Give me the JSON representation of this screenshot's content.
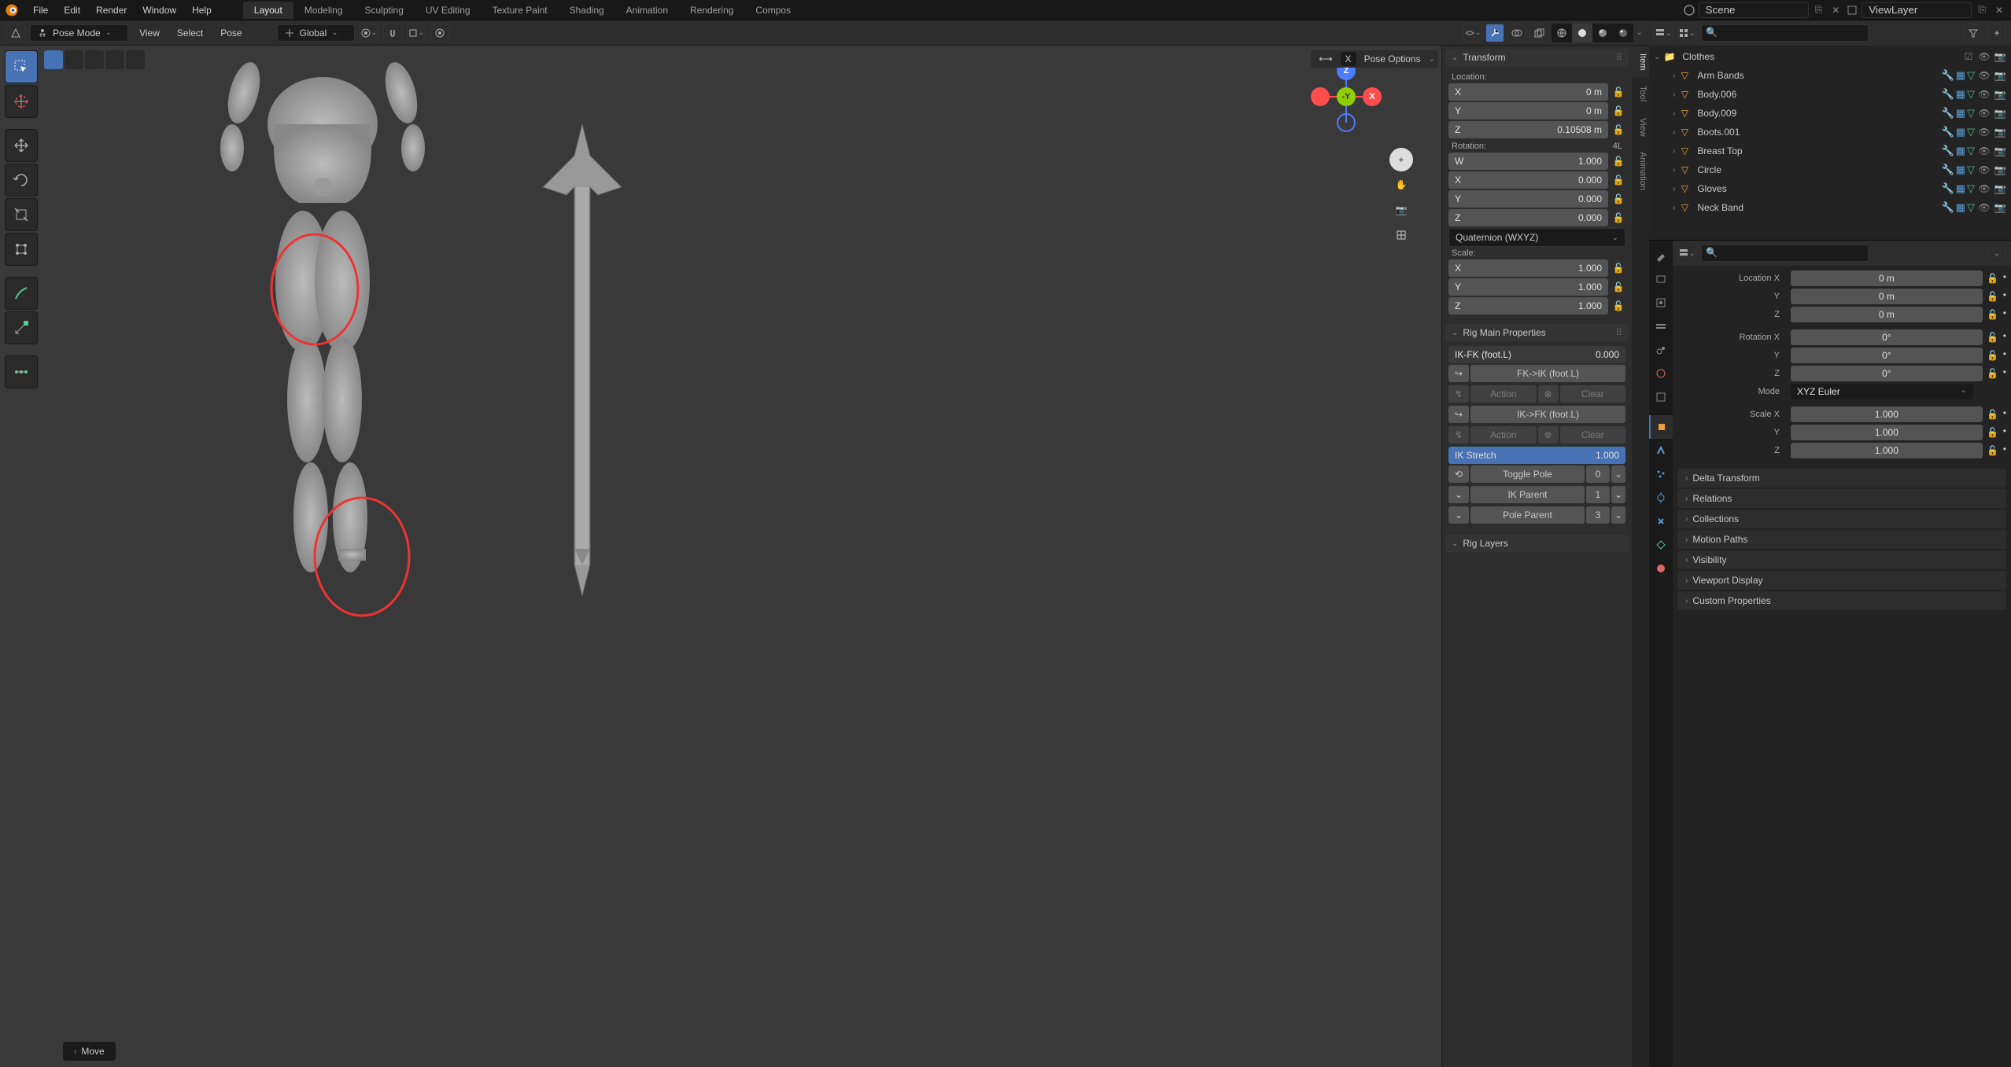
{
  "top_menu": [
    "File",
    "Edit",
    "Render",
    "Window",
    "Help"
  ],
  "workspaces": [
    "Layout",
    "Modeling",
    "Sculpting",
    "UV Editing",
    "Texture Paint",
    "Shading",
    "Animation",
    "Rendering",
    "Compos"
  ],
  "active_workspace": "Layout",
  "scene_name": "Scene",
  "view_layer": "ViewLayer",
  "viewport": {
    "mode": "Pose Mode",
    "menus": [
      "View",
      "Select",
      "Pose"
    ],
    "orientation": "Global",
    "pose_options": "Pose Options"
  },
  "transform_panel": {
    "title": "Transform",
    "location_label": "Location:",
    "location": {
      "X": "0 m",
      "Y": "0 m",
      "Z": "0.10508 m"
    },
    "rotation_label": "Rotation:",
    "rotation_mode_badge": "4L",
    "rotation": {
      "W": "1.000",
      "X": "0.000",
      "Y": "0.000",
      "Z": "0.000"
    },
    "rotation_mode": "Quaternion (WXYZ)",
    "scale_label": "Scale:",
    "scale": {
      "X": "1.000",
      "Y": "1.000",
      "Z": "1.000"
    }
  },
  "rig_panel": {
    "title": "Rig Main Properties",
    "ikfk_label": "IK-FK (foot.L)",
    "ikfk_value": "0.000",
    "fk_to_ik": "FK->IK (foot.L)",
    "ik_to_fk": "IK->FK (foot.L)",
    "action": "Action",
    "clear": "Clear",
    "ik_stretch_label": "IK Stretch",
    "ik_stretch_value": "1.000",
    "toggle_pole": "Toggle Pole",
    "toggle_pole_value": "0",
    "ik_parent": "IK Parent",
    "ik_parent_value": "1",
    "pole_parent": "Pole Parent",
    "pole_parent_value": "3",
    "rig_layers": "Rig Layers"
  },
  "n_tabs": [
    "Item",
    "Tool",
    "View",
    "Animation"
  ],
  "outliner": {
    "collection": "Clothes",
    "items": [
      "Arm Bands",
      "Body.006",
      "Body.009",
      "Boots.001",
      "Breast Top",
      "Circle",
      "Gloves",
      "Neck Band"
    ]
  },
  "properties": {
    "location_x": "Location X",
    "rotation_x": "Rotation X",
    "scale_x": "Scale X",
    "mode_label": "Mode",
    "mode_value": "XYZ Euler",
    "loc": {
      "x": "0 m",
      "y": "0 m",
      "z": "0 m"
    },
    "rot": {
      "x": "0°",
      "y": "0°",
      "z": "0°"
    },
    "scale": {
      "x": "1.000",
      "y": "1.000",
      "z": "1.000"
    },
    "sections": [
      "Delta Transform",
      "Relations",
      "Collections",
      "Motion Paths",
      "Visibility",
      "Viewport Display",
      "Custom Properties"
    ]
  },
  "status": "Move",
  "axis_labels": {
    "x": "X",
    "y": "-Y",
    "z": "Z"
  },
  "y_label": "Y",
  "z_label": "Z"
}
